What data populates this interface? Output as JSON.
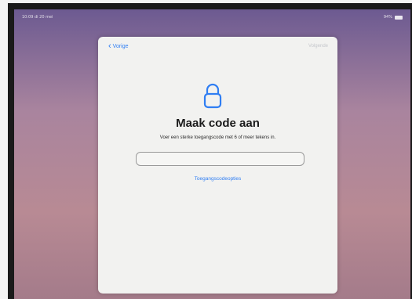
{
  "status_bar": {
    "time": "10:09 di 20 mei",
    "battery": "94%"
  },
  "nav": {
    "back_label": "Vorige",
    "next_label": "Volgende"
  },
  "content": {
    "title": "Maak code aan",
    "subtitle": "Voer een sterke toegangscode met 6 of meer tekens in.",
    "code_value": "",
    "options_link": "Toegangscodeopties"
  },
  "colors": {
    "accent": "#2f7ef3",
    "sheet": "#f2f2f0",
    "disabled": "#c5c7cc"
  },
  "icons": {
    "lock": "lock-icon",
    "back": "chevron-left-icon"
  }
}
